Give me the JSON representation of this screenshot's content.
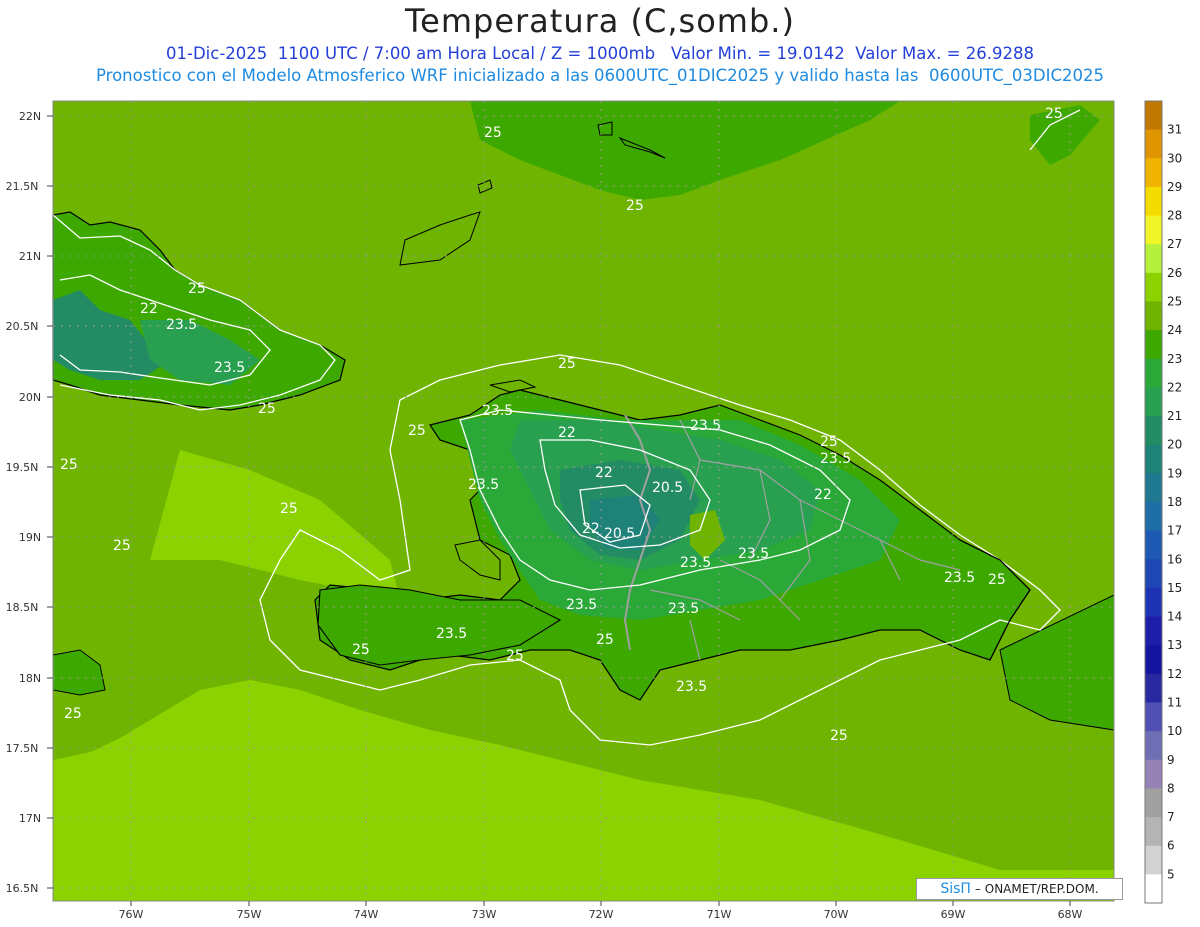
{
  "header": {
    "title": "Temperatura (C,somb.)",
    "line1": "01-Dic-2025  1100 UTC / 7:00 am Hora Local / Z = 1000mb   Valor Min. = 19.0142  Valor Max. = 26.9288",
    "line2": "Pronostico con el Modelo Atmosferico WRF inicializado a las 0600UTC_01DIC2025 y valido hasta las  0600UTC_03DIC2025"
  },
  "lat_labels": [
    "22N",
    "21.5N",
    "21N",
    "20.5N",
    "20N",
    "19.5N",
    "19N",
    "18.5N",
    "18N",
    "17.5N",
    "17N",
    "16.5N"
  ],
  "lon_labels": [
    "76W",
    "75W",
    "74W",
    "73W",
    "72W",
    "71W",
    "70W",
    "69W",
    "68W"
  ],
  "colorbar": {
    "levels": [
      "31",
      "30",
      "29",
      "28",
      "27",
      "26",
      "25",
      "24",
      "23",
      "22",
      "21",
      "20",
      "19",
      "18",
      "17",
      "16",
      "15",
      "14",
      "13",
      "12",
      "11",
      "10",
      "9",
      "8",
      "7",
      "6",
      "5"
    ],
    "colors": [
      "#c07800",
      "#e09600",
      "#f0b400",
      "#f5dc00",
      "#f0f528",
      "#b4f03c",
      "#8cd200",
      "#6eb400",
      "#3ca800",
      "#2aa838",
      "#28a050",
      "#248c64",
      "#1e8278",
      "#1e7890",
      "#1e6ea8",
      "#1e5ab4",
      "#1e46b4",
      "#1e32b4",
      "#1e1ea8",
      "#1414a0",
      "#2828a0",
      "#5050b4",
      "#6e6eb4",
      "#9682b4",
      "#a0a0a0",
      "#b4b4b4",
      "#d2d2d2",
      "#ffffff"
    ]
  },
  "contour_labels": [
    {
      "text": "25"
    },
    {
      "text": "25"
    },
    {
      "text": "25"
    },
    {
      "text": "22"
    },
    {
      "text": "23.5"
    },
    {
      "text": "25"
    },
    {
      "text": "23.5"
    },
    {
      "text": "25"
    },
    {
      "text": "25"
    },
    {
      "text": "25"
    },
    {
      "text": "25"
    },
    {
      "text": "23.5"
    },
    {
      "text": "22"
    },
    {
      "text": "23.5"
    },
    {
      "text": "25"
    },
    {
      "text": "23.5"
    },
    {
      "text": "22"
    },
    {
      "text": "20.5"
    },
    {
      "text": "23.5"
    },
    {
      "text": "22"
    },
    {
      "text": "22"
    },
    {
      "text": "20.5"
    },
    {
      "text": "23.5"
    },
    {
      "text": "23.5"
    },
    {
      "text": "23.5"
    },
    {
      "text": "25"
    },
    {
      "text": "23.5"
    },
    {
      "text": "23.5"
    },
    {
      "text": "23.5"
    },
    {
      "text": "25"
    },
    {
      "text": "25"
    },
    {
      "text": "25"
    },
    {
      "text": "23.5"
    },
    {
      "text": "25"
    },
    {
      "text": "25"
    },
    {
      "text": "25"
    },
    {
      "text": "25"
    }
  ],
  "credit": {
    "sis": "SisΠ",
    "org": "– ONAMET/REP.DOM."
  },
  "colors": {
    "sea_warm": "#6eb400",
    "sea_cool": "#8cd200",
    "land_24": "#3ca800",
    "land_23": "#2aa838",
    "land_22": "#28a050",
    "land_21": "#248c64",
    "coast": "#000000",
    "border": "#a0a0a0",
    "contour": "#ffffff"
  }
}
